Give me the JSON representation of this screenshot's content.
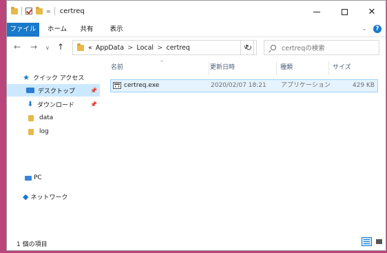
{
  "window": {
    "title": "certreq"
  },
  "quick_access_toolbar": {
    "dropdown": "="
  },
  "ribbon": {
    "tabs": [
      "ファイル",
      "ホーム",
      "共有",
      "表示"
    ],
    "expand_icon": "chevron-down-icon",
    "help": "?"
  },
  "address_bar": {
    "overflow": "«",
    "breadcrumbs": [
      "AppData",
      "Local",
      "certreq"
    ],
    "separator": ">"
  },
  "search": {
    "placeholder": "certreqの検索"
  },
  "nav": {
    "quick_access": "クイック アクセス",
    "desktop": "デスクトップ",
    "downloads": "ダウンロード",
    "data": "data",
    "log": "log",
    "pc": "PC",
    "network": "ネットワーク"
  },
  "columns": {
    "name": "名前",
    "modified": "更新日時",
    "type": "種類",
    "size": "サイズ"
  },
  "files": [
    {
      "name": "certreq.exe",
      "modified": "2020/02/07 18:21",
      "type": "アプリケーション",
      "size": "429 KB"
    }
  ],
  "status": {
    "item_count": "1 個の項目"
  },
  "colors": {
    "accent": "#1979ca",
    "selection": "#cce8ff",
    "desktop_bg": "#b9457a"
  }
}
